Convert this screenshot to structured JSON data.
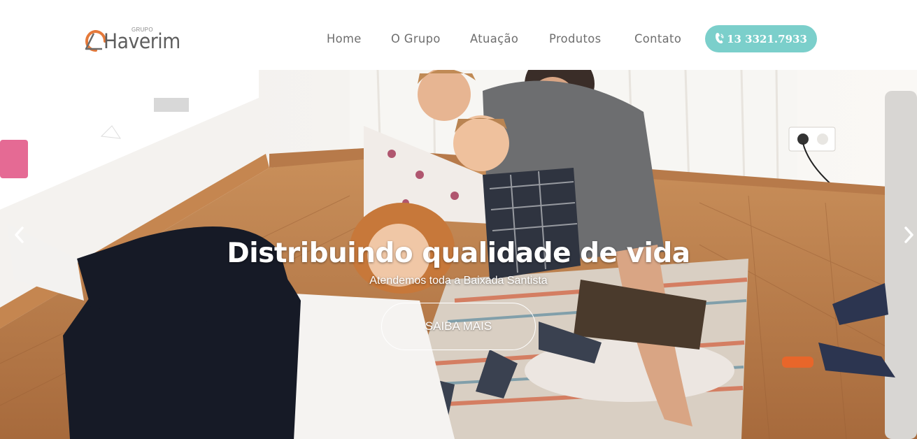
{
  "header": {
    "logo": {
      "small_text": "GRUPO",
      "brand_text": "Haverim"
    },
    "nav": [
      {
        "label": "Home"
      },
      {
        "label": "O Grupo"
      },
      {
        "label": "Atuação"
      },
      {
        "label": "Produtos"
      },
      {
        "label": "Contato"
      }
    ],
    "phone": {
      "label": "13 3321.7933",
      "icon": "phone-icon"
    }
  },
  "hero": {
    "title": "Distribuindo qualidade de vida",
    "subtitle": "Atendemos toda a Baixada Santista",
    "cta_label": "SAIBA MAIS",
    "prev_icon": "chevron-left-icon",
    "next_icon": "chevron-right-icon",
    "image_description_icon": "family-photo"
  },
  "colors": {
    "accent": "#7bcfcb",
    "logo_orange": "#e5793a",
    "nav_text": "#6e6e6e",
    "white": "#ffffff"
  }
}
